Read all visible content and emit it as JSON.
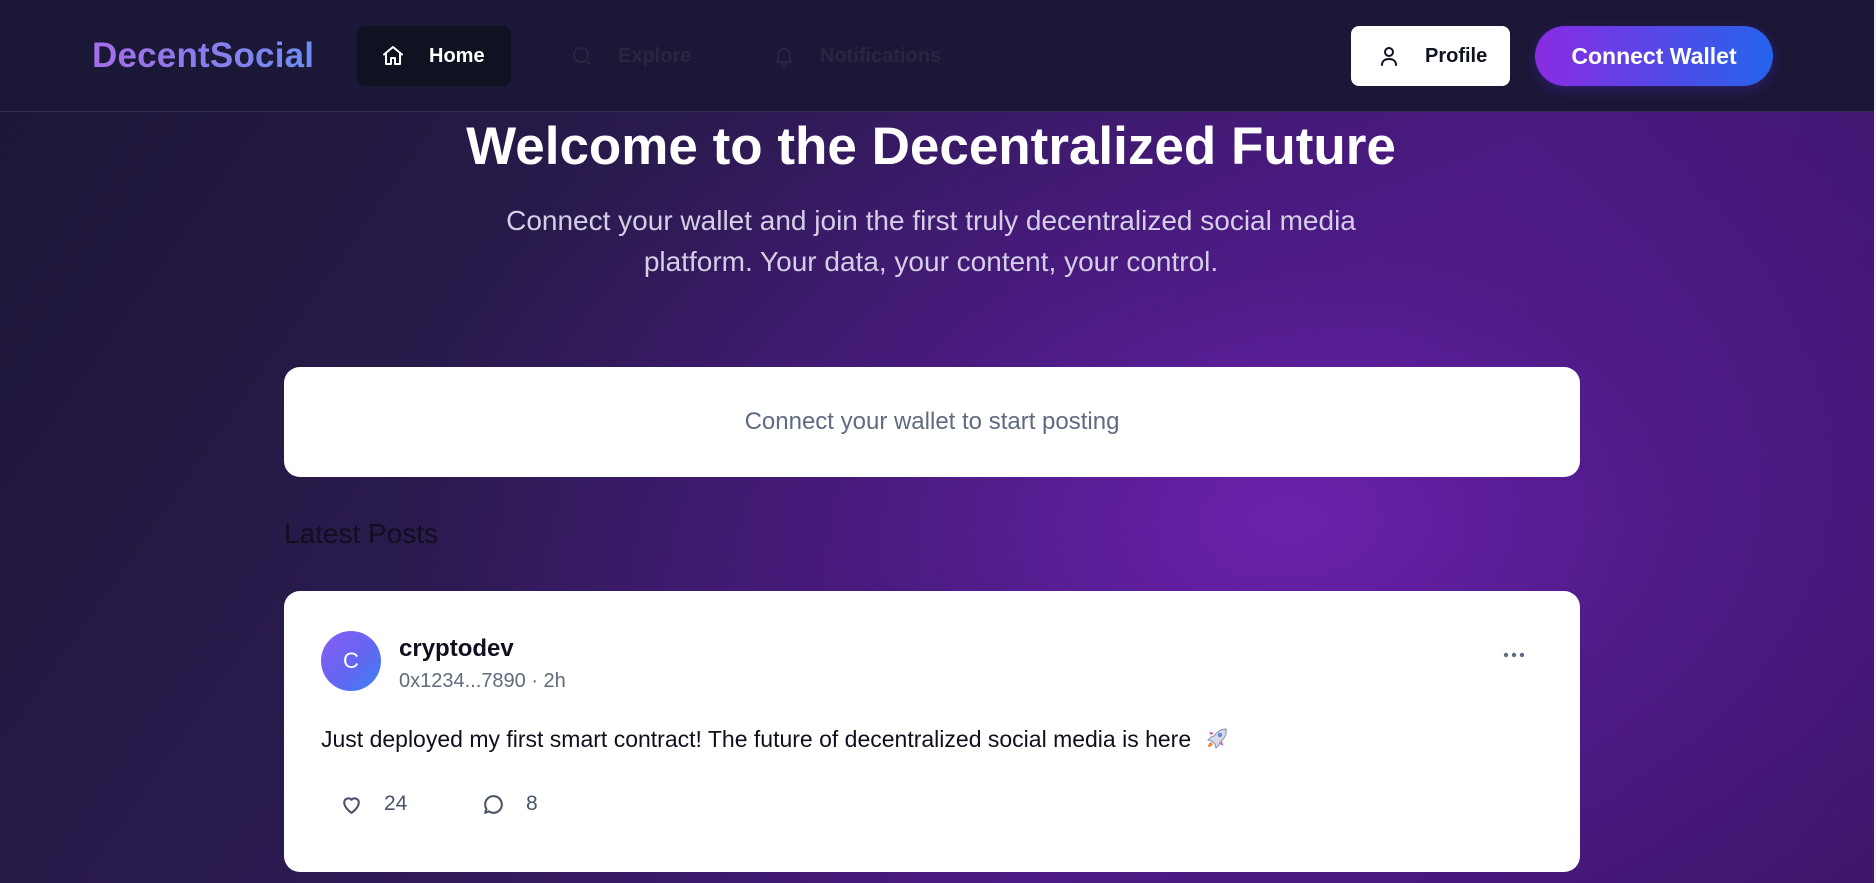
{
  "header": {
    "brand": "DecentSocial",
    "nav": [
      {
        "label": "Home",
        "icon": "home-icon",
        "active": true
      },
      {
        "label": "Explore",
        "icon": "search-icon",
        "active": false
      },
      {
        "label": "Notifications",
        "icon": "bell-icon",
        "active": false
      }
    ],
    "profile_label": "Profile",
    "profile_icon": "user-icon",
    "connect_label": "Connect Wallet"
  },
  "hero": {
    "title": "Welcome to the Decentralized Future",
    "subtitle_line1": "Connect your wallet and join the first truly decentralized social media",
    "subtitle_line2": "platform. Your data, your content, your control."
  },
  "composer": {
    "prompt": "Connect your wallet to start posting"
  },
  "feed": {
    "heading": "Latest Posts",
    "posts": [
      {
        "avatar_initial": "C",
        "username": "cryptodev",
        "meta": "0x1234...7890 · 2h",
        "content": "Just deployed my first smart contract! The future of decentralized social media is here",
        "likes": "24",
        "comments": "8"
      }
    ]
  },
  "colors": {
    "accent_start": "#8a2be2",
    "accent_end": "#2563eb",
    "header_bg": "#1b1736",
    "card_bg": "#ffffff"
  }
}
